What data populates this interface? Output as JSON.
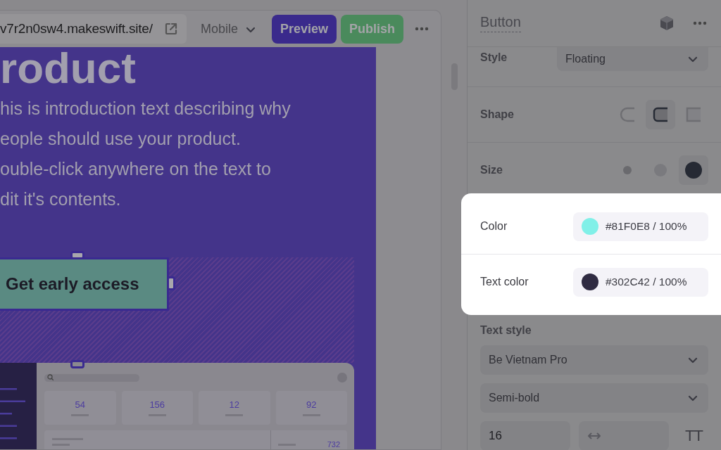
{
  "toolbar": {
    "url": "v7r2n0sw4.makeswift.site/",
    "device": "Mobile",
    "buttons": [
      {
        "label": "Preview",
        "kind": "preview"
      },
      {
        "label": "Publish",
        "kind": "publish"
      }
    ]
  },
  "canvas": {
    "heading": "roduct",
    "intro_lines": [
      "his is introduction text describing why",
      "eople should use your product.",
      "ouble-click anywhere on the text to",
      "dit it's contents."
    ],
    "cta": "Get early access",
    "dashboard": {
      "stats": [
        "54",
        "156",
        "12",
        "92"
      ],
      "row_value": "732"
    }
  },
  "inspector": {
    "title": "Button",
    "style": {
      "label": "Style",
      "value": "Floating"
    },
    "shape": {
      "label": "Shape",
      "options": [
        {
          "kind": "pill",
          "selected": false
        },
        {
          "kind": "rounded",
          "selected": true
        },
        {
          "kind": "square",
          "selected": false
        }
      ]
    },
    "size": {
      "label": "Size",
      "options": [
        {
          "kind": "small",
          "selected": false
        },
        {
          "kind": "medium",
          "selected": false
        },
        {
          "kind": "large",
          "selected": true
        }
      ]
    },
    "colors": [
      {
        "label": "Color",
        "value": "#81F0E8 / 100%",
        "color": "#81f0e8"
      },
      {
        "label": "Text color",
        "value": "#302C42 / 100%",
        "color": "#302c42"
      }
    ],
    "text_style": {
      "label": "Text style",
      "font": "Be Vietnam Pro",
      "weight": "Semi-bold",
      "size": "16",
      "transform": "TT"
    }
  }
}
